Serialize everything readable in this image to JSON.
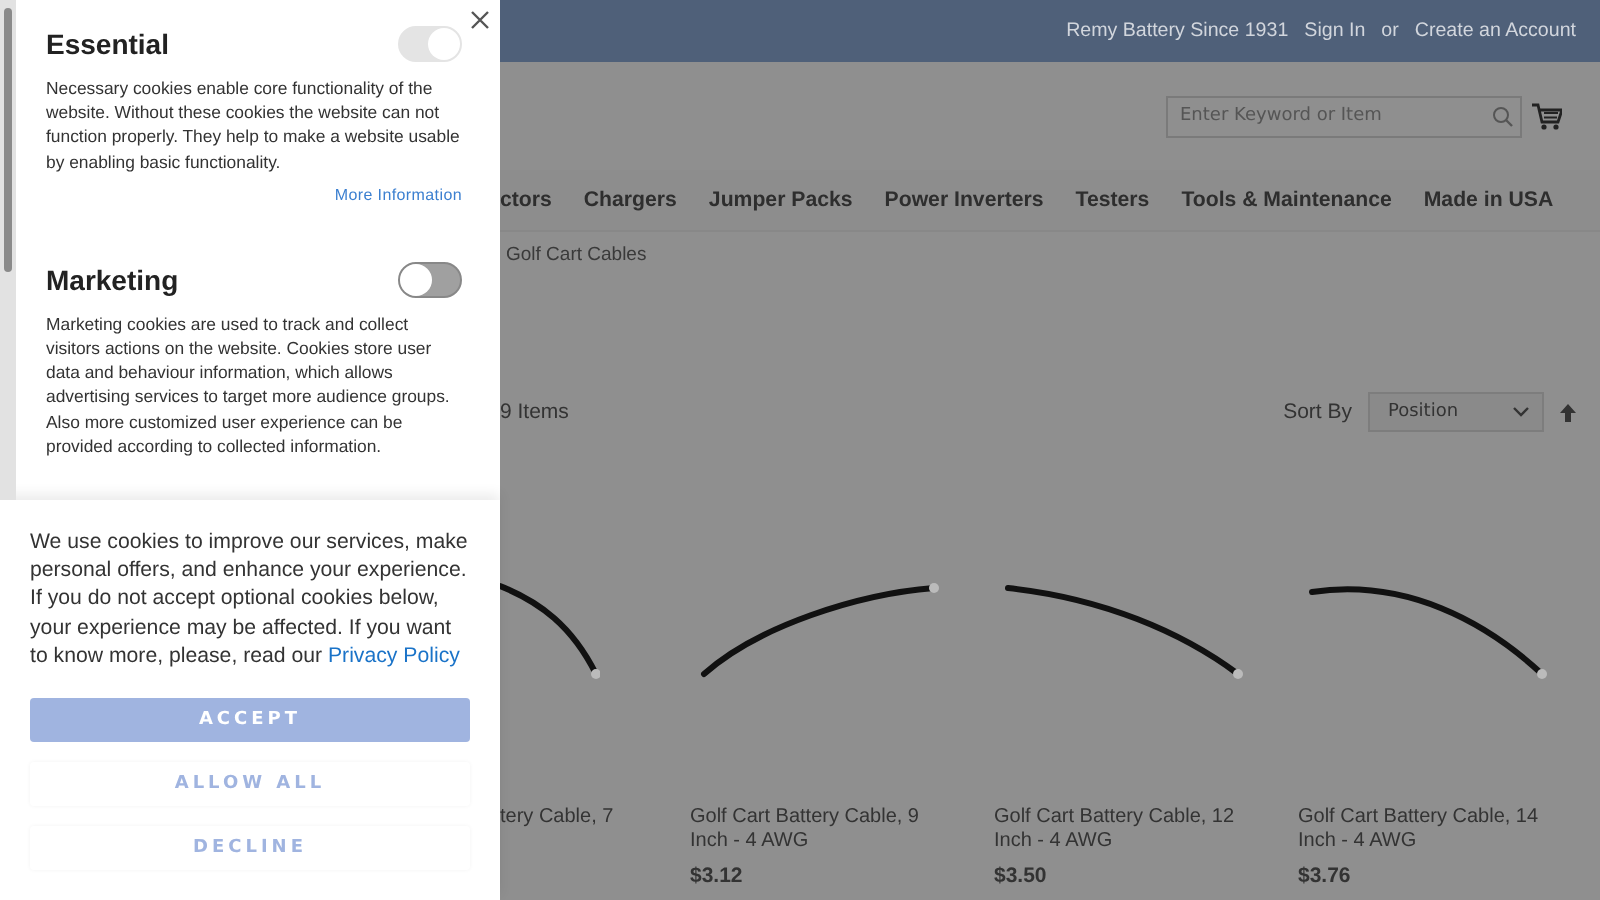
{
  "header": {
    "tagline": "Remy Battery Since 1931",
    "sign_in": "Sign In",
    "or": "or",
    "create_account": "Create an Account"
  },
  "search": {
    "placeholder": "Enter Keyword or Item"
  },
  "nav": [
    "ctors",
    "Chargers",
    "Jumper Packs",
    "Power Inverters",
    "Testers",
    "Tools & Maintenance",
    "Made in USA"
  ],
  "breadcrumb": "Golf Cart Cables",
  "toolbar": {
    "count": "9 Items",
    "sort_label": "Sort By",
    "sort_value": "Position"
  },
  "products": [
    {
      "name": "tery Cable, 7"
    },
    {
      "name": "Golf Cart Battery Cable, 9 Inch - 4 AWG",
      "price": "$3.12"
    },
    {
      "name": "Golf Cart Battery Cable, 12 Inch - 4 AWG",
      "price": "$3.50"
    },
    {
      "name": "Golf Cart Battery Cable, 14 Inch - 4 AWG",
      "price": "$3.76"
    }
  ],
  "cookie_panel": {
    "sections": [
      {
        "title": "Essential",
        "description": "Necessary cookies enable core functionality of the website. Without these cookies the website can not function properly. They help to make a website usable by enabling basic functionality.",
        "on": true,
        "disabled": true,
        "link": "More Information"
      },
      {
        "title": "Marketing",
        "description": "Marketing cookies are used to track and collect visitors actions on the website. Cookies store user data and behaviour information, which allows advertising services to target more audience groups. Also more customized user experience can be provided according to collected information.",
        "on": false,
        "disabled": false
      }
    ],
    "notice": "We use cookies to improve our services, make personal offers, and enhance your experience. If you do not accept optional cookies below, your experience may be affected. If you want to know more, please, read our ",
    "notice_link": "Privacy Policy",
    "buttons": [
      {
        "label": "ACCEPT",
        "kind": "primary"
      },
      {
        "label": "ALLOW ALL",
        "kind": "secondary"
      },
      {
        "label": "DECLINE",
        "kind": "secondary"
      }
    ]
  }
}
